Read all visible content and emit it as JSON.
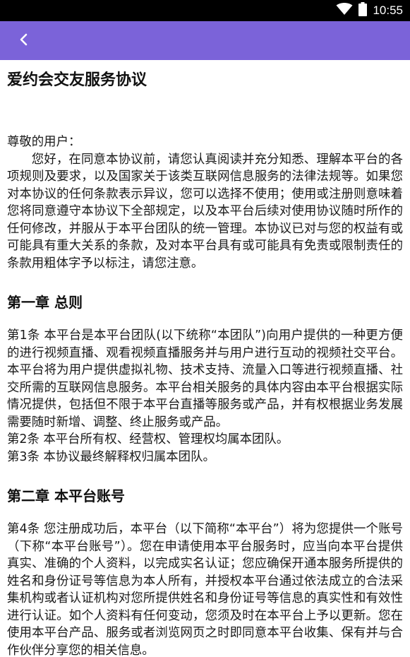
{
  "status_bar": {
    "time": "10:55",
    "icons": [
      "wifi-icon",
      "battery-icon"
    ]
  },
  "app_bar": {
    "back_icon": "chevron-left-icon",
    "color": "#7b63d9"
  },
  "document": {
    "title": "爱约会交友服务协议",
    "greeting": "尊敬的用户：",
    "intro": "您好，在同意本协议前，请您认真阅读并充分知悉、理解本平台的各项规则及要求，以及国家关于该类互联网信息服务的法律法规等。如果您对本协议的任何条款表示异议，您可以选择不使用；使用或注册则意味着您将同意遵守本协议下全部规定，以及本平台后续对使用协议随时所作的任何修改，并服从于本平台团队的统一管理。本协议已对与您的权益有或可能具有重大关系的条款，及对本平台具有或可能具有免责或限制责任的条款用粗体字予以标注，请您注意。",
    "chapter1": {
      "heading": "第一章 总则",
      "articles": [
        "第1条 本平台是本平台团队(以下统称“本团队”)向用户提供的一种更方便的进行视频直播、观看视频直播服务并与用户进行互动的视频社交平台。本平台将为用户提供虚拟礼物、技术支持、流量入口等进行视频直播、社交所需的互联网信息服务。本平台相关服务的具体内容由本平台根据实际情况提供，包括但不限于本平台直播等服务或产品，并有权根据业务发展需要随时新增、调整、终止服务或产品。",
        "第2条 本平台所有权、经营权、管理权均属本团队。",
        "第3条 本协议最终解释权归属本团队。"
      ]
    },
    "chapter2": {
      "heading": "第二章 本平台账号",
      "articles": [
        "第4条 您注册成功后，本平台（以下简称“本平台”）将为您提供一个账号（下称“本平台账号”）。您在申请使用本平台服务时，应当向本平台提供真实、准确的个人资料，以完成实名认证；您应确保开通本服务所提供的姓名和身份证号等信息为本人所有，并授权本平台通过依法成立的合法采集机构或者认证机构对您所提供姓名和身份证号等信息的真实性和有效性进行认证。如个人资料有任何变动，您须及时在本平台上予以更新。您在使用本平台产品、服务或者浏览网页之时即同意本平台收集、保有并与合作伙伴分享您的相关信息。"
      ]
    }
  }
}
